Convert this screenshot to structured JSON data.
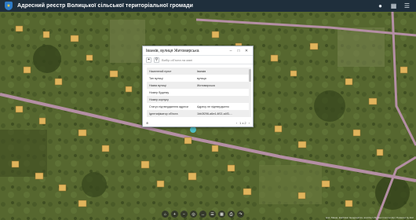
{
  "header": {
    "title": "Адресний реєстр Волицької сільської територіальної громади",
    "icons": [
      "logo-icon",
      "user-icon",
      "grid-icon",
      "menu-icon"
    ]
  },
  "popup": {
    "title": "Іванків, вулиця Житомирська",
    "search_placeholder": "Вибір об'єкта на мапі",
    "attributes": [
      {
        "key": "Населений пункт",
        "value": "Іванків"
      },
      {
        "key": "Тип вулиці",
        "value": "вулиця"
      },
      {
        "key": "Назва вулиці",
        "value": "Житомирська"
      },
      {
        "key": "Номер будинку",
        "value": ""
      },
      {
        "key": "Номер корпусу",
        "value": ""
      },
      {
        "key": "Статус підтвердження адреси",
        "value": "Адресу не підтверджено"
      },
      {
        "key": "Ідентифікатор об'єкта",
        "value": "1bb3f296-a6e4-4f02-a4f3-..."
      }
    ],
    "pager": "1 з 2"
  },
  "map": {
    "bottom_tools": [
      "home-icon",
      "zoom-in-icon",
      "zoom-out-icon",
      "locate-icon",
      "measure-icon",
      "layers-icon",
      "basemap-icon",
      "print-icon",
      "share-icon"
    ],
    "attribution": "Esri, Maxar, Earthstar Geographics, and the GIS User Community | Powered by Esri"
  }
}
